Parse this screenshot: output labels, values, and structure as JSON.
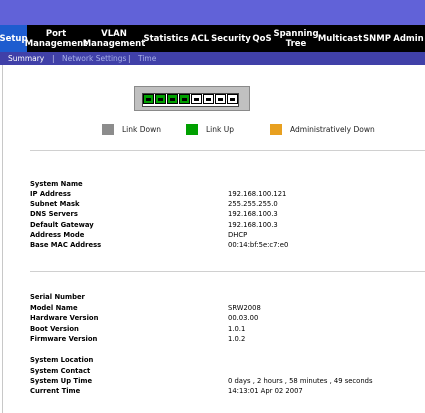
{
  "nav": {
    "items": [
      {
        "line1": "Setup",
        "line2": ""
      },
      {
        "line1": "Port",
        "line2": "Management"
      },
      {
        "line1": "VLAN",
        "line2": "Management"
      },
      {
        "line1": "Statistics",
        "line2": ""
      },
      {
        "line1": "ACL",
        "line2": ""
      },
      {
        "line1": "Security",
        "line2": ""
      },
      {
        "line1": "QoS",
        "line2": ""
      },
      {
        "line1": "Spanning",
        "line2": "Tree"
      },
      {
        "line1": "Multicast",
        "line2": ""
      },
      {
        "line1": "SNMP",
        "line2": ""
      },
      {
        "line1": "Admin",
        "line2": ""
      }
    ],
    "active": "Setup"
  },
  "subnav": {
    "items": [
      "Summary",
      "Network Settings",
      "Time"
    ],
    "separator": "|"
  },
  "switch_panel": {
    "ports": [
      "up",
      "up",
      "up",
      "up",
      "down",
      "down",
      "down",
      "down"
    ]
  },
  "legend": {
    "items": [
      {
        "label": "Link Down",
        "color": "#8c8c8c"
      },
      {
        "label": "Link Up",
        "color": "#00a000"
      },
      {
        "label": "Administratively Down",
        "color": "#e8a020"
      }
    ]
  },
  "system_info": [
    {
      "label": "System Name",
      "value": ""
    },
    {
      "label": "IP Address",
      "value": "192.168.100.121"
    },
    {
      "label": "Subnet Mask",
      "value": "255.255.255.0"
    },
    {
      "label": "DNS Servers",
      "value": "192.168.100.3"
    },
    {
      "label": "Default Gateway",
      "value": "192.168.100.3"
    },
    {
      "label": "Address Mode",
      "value": "DHCP"
    },
    {
      "label": "Base MAC Address",
      "value": "00:14:bf:5e:c7:e0"
    }
  ],
  "hardware_info": [
    {
      "label": "Serial Number",
      "value": ""
    },
    {
      "label": "Model Name",
      "value": "SRW2008"
    },
    {
      "label": "Hardware Version",
      "value": "00.03.00"
    },
    {
      "label": "Boot Version",
      "value": "1.0.1"
    },
    {
      "label": "Firmware Version",
      "value": "1.0.2"
    }
  ],
  "status_info": [
    {
      "label": "System Location",
      "value": ""
    },
    {
      "label": "System Contact",
      "value": ""
    },
    {
      "label": "System Up Time",
      "value": "0 days , 2 hours , 58 minutes , 49 seconds"
    },
    {
      "label": "Current Time",
      "value": "14:13:01   Apr 02 2007"
    }
  ]
}
